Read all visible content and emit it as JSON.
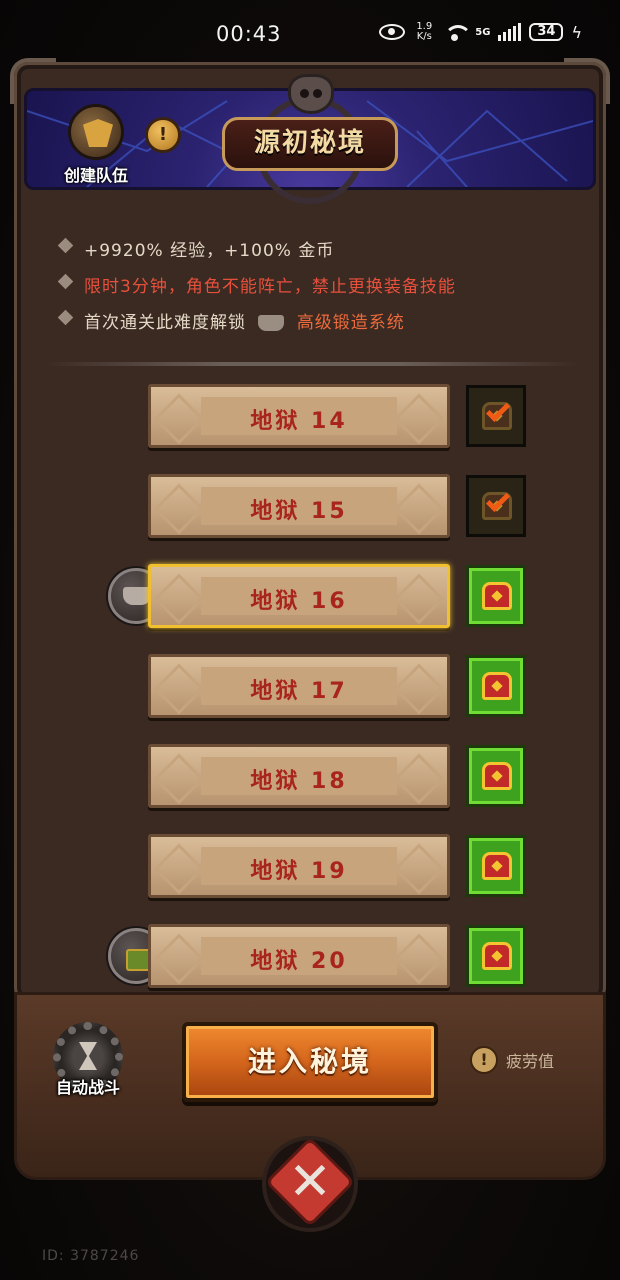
{
  "status_bar": {
    "time": "00:43",
    "net_speed_value": "1.9",
    "net_speed_unit": "K/s",
    "network_type": "5G",
    "battery": "34"
  },
  "header": {
    "title": "源初秘境",
    "create_team_label": "创建队伍",
    "info_symbol": "!"
  },
  "rewards": {
    "line1": "+9920% 经验，+100% 金币",
    "line2": "限时3分钟，角色不能阵亡，禁止更换装备技能",
    "line3_prefix": "首次通关此难度解锁",
    "line3_unlock": "高级锻造系统"
  },
  "levels": [
    {
      "label": "地狱 14",
      "status": "completed",
      "icon": "check-icon"
    },
    {
      "label": "地狱 15",
      "status": "completed",
      "icon": "check-icon"
    },
    {
      "label": "地狱 16",
      "status": "selected",
      "icon": "chest-icon",
      "side_icon": "anvil-icon"
    },
    {
      "label": "地狱 17",
      "status": "available",
      "icon": "chest-icon"
    },
    {
      "label": "地狱 18",
      "status": "available",
      "icon": "chest-icon"
    },
    {
      "label": "地狱 19",
      "status": "available",
      "icon": "chest-icon"
    },
    {
      "label": "地狱 20",
      "status": "available",
      "icon": "chest-icon",
      "side_icon": "lock-icon"
    }
  ],
  "controls": {
    "auto_battle_label": "自动战斗",
    "enter_button_label": "进入秘境",
    "fatigue_label": "疲劳值",
    "fatigue_symbol": "!",
    "close_symbol": "✕"
  },
  "footer": {
    "account_id": "ID: 3787246"
  },
  "colors": {
    "accent_orange": "#d4661c",
    "warning_red": "#e8503c",
    "completed_check": "#f05a14",
    "available_green": "#3fa21e",
    "selected_border": "#f0c030"
  }
}
